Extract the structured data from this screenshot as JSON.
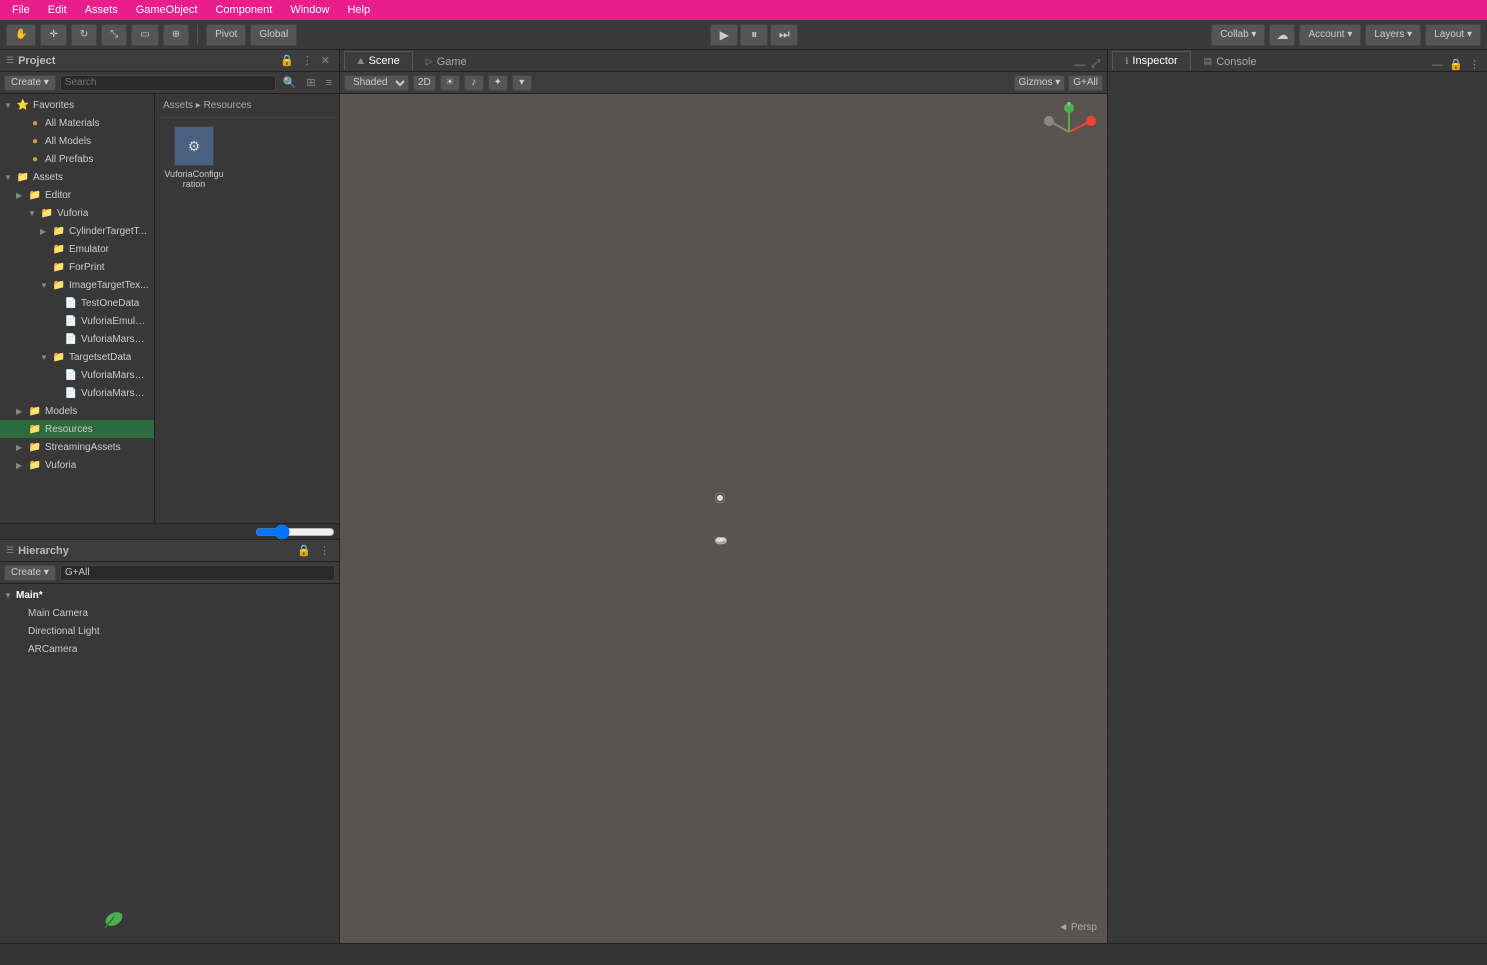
{
  "menuBar": {
    "items": [
      "File",
      "Edit",
      "Assets",
      "GameObject",
      "Component",
      "Window",
      "Help"
    ]
  },
  "toolbar": {
    "pivotLabel": "Pivot",
    "globalLabel": "Global",
    "collabLabel": "Collab ▾",
    "accountLabel": "Account ▾",
    "layersLabel": "Layers ▾",
    "layoutLabel": "Layout ▾"
  },
  "projectPanel": {
    "title": "Project",
    "createLabel": "Create ▾",
    "searchPlaceholder": "Search",
    "breadcrumb": "Assets ▸ Resources",
    "favorites": {
      "label": "Favorites",
      "items": [
        "All Materials",
        "All Models",
        "All Prefabs"
      ]
    },
    "assets": {
      "label": "Assets",
      "children": [
        {
          "label": "Editor",
          "indent": 1
        },
        {
          "label": "Vuforia",
          "indent": 2
        },
        {
          "label": "CylinderTargetT...",
          "indent": 3
        },
        {
          "label": "Emulator",
          "indent": 3
        },
        {
          "label": "ForPrint",
          "indent": 3
        },
        {
          "label": "ImageTargetTex...",
          "indent": 3
        },
        {
          "label": "TestOneData",
          "indent": 4
        },
        {
          "label": "VuforiaEmulat...",
          "indent": 4
        },
        {
          "label": "VuforiaMars_E...",
          "indent": 4
        },
        {
          "label": "TargetsetData",
          "indent": 3
        },
        {
          "label": "VuforiaMars_Mo...",
          "indent": 4
        },
        {
          "label": "VuforiaMars_Vuf...",
          "indent": 4
        },
        {
          "label": "Models",
          "indent": 1
        },
        {
          "label": "Resources",
          "indent": 1,
          "selected": true
        },
        {
          "label": "StreamingAssets",
          "indent": 1
        },
        {
          "label": "Vuforia",
          "indent": 1
        }
      ]
    },
    "resourcesFile": "VuforiaConfiguration"
  },
  "hierarchyPanel": {
    "title": "Hierarchy",
    "createLabel": "Create ▾",
    "searchPlaceholder": "G+All",
    "scene": "Main*",
    "objects": [
      "Main Camera",
      "Directional Light",
      "ARCamera"
    ]
  },
  "scenePanel": {
    "sceneTab": "Scene",
    "gameTab": "Game",
    "shading": "Shaded",
    "twoDMode": "2D",
    "gizmosLabel": "Gizmos ▾",
    "allLabel": "G+All",
    "perspLabel": "◄ Persp"
  },
  "inspectorPanel": {
    "title": "Inspector",
    "consoleTab": "Console"
  },
  "icons": {
    "play": "▶",
    "pause": "⏸",
    "step": "⏭",
    "lock": "🔒",
    "folder": "📁",
    "file": "📄",
    "config": "⚙",
    "cloud": "☁",
    "search": "🔍"
  }
}
